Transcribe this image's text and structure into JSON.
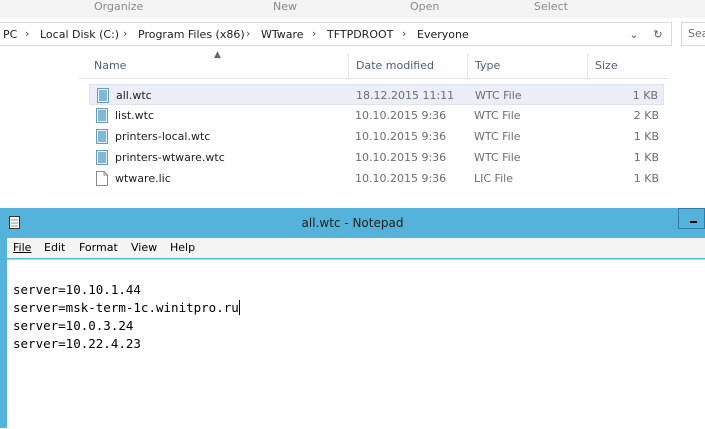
{
  "ribbon": {
    "organize": "Organize",
    "new": "New",
    "open": "Open",
    "select": "Select"
  },
  "address": {
    "breadcrumbs": [
      "PC",
      "Local Disk (C:)",
      "Program Files (x86)",
      "WTware",
      "TFTPDROOT",
      "Everyone"
    ],
    "search_partial": "Sea"
  },
  "columns": {
    "name": "Name",
    "date": "Date modified",
    "type": "Type",
    "size": "Size"
  },
  "files": [
    {
      "name": "all.wtc",
      "date": "18.12.2015 11:11",
      "type": "WTC File",
      "size": "1 KB",
      "icon": "wtc-file-icon"
    },
    {
      "name": "list.wtc",
      "date": "10.10.2015 9:36",
      "type": "WTC File",
      "size": "2 KB",
      "icon": "wtc-file-icon"
    },
    {
      "name": "printers-local.wtc",
      "date": "10.10.2015 9:36",
      "type": "WTC File",
      "size": "1 KB",
      "icon": "wtc-file-icon"
    },
    {
      "name": "printers-wtware.wtc",
      "date": "10.10.2015 9:36",
      "type": "WTC File",
      "size": "1 KB",
      "icon": "wtc-file-icon"
    },
    {
      "name": "wtware.lic",
      "date": "10.10.2015 9:36",
      "type": "LIC File",
      "size": "1 KB",
      "icon": "blank-file-icon"
    }
  ],
  "notepad": {
    "title": "all.wtc - Notepad",
    "menu": [
      "File",
      "Edit",
      "Format",
      "View",
      "Help"
    ],
    "lines": [
      "server=10.10.1.44",
      "server=msk-term-1c.winitpro.ru",
      "server=10.0.3.24",
      "server=10.22.4.23"
    ]
  },
  "colors": {
    "notepad_frame": "#55b3db",
    "selection": "#e9eef7"
  }
}
